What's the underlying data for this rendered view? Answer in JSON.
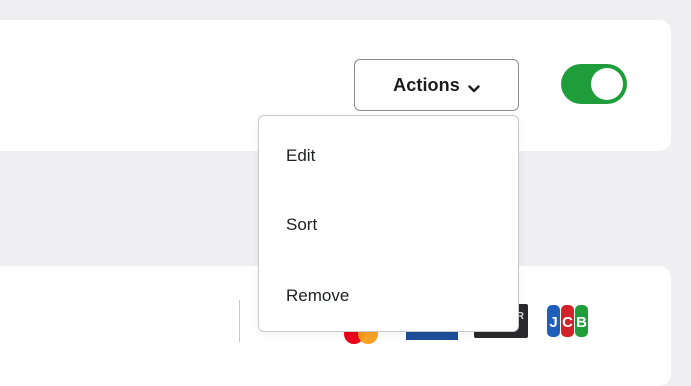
{
  "toolbar": {
    "actions_label": "Actions",
    "actions_icon": "chevron-down-icon"
  },
  "toggle": {
    "state": "on",
    "color": "#1f9d3a"
  },
  "actions_menu": {
    "items": [
      {
        "label": "Edit"
      },
      {
        "label": "Sort"
      },
      {
        "label": "Remove"
      }
    ]
  },
  "payment_logos": {
    "icons": [
      "mastercard-icon",
      "card-network-icon",
      "card-network-icon",
      "jcb-icon"
    ],
    "dark_card_mark": "R",
    "jcb_text": "JCB"
  },
  "colors": {
    "background": "#efeef1",
    "card": "#ffffff",
    "toggle_on": "#1f9d3a",
    "jcb_blue": "#1f5fb7",
    "jcb_red": "#d2232a",
    "jcb_green": "#1f9d3a"
  }
}
